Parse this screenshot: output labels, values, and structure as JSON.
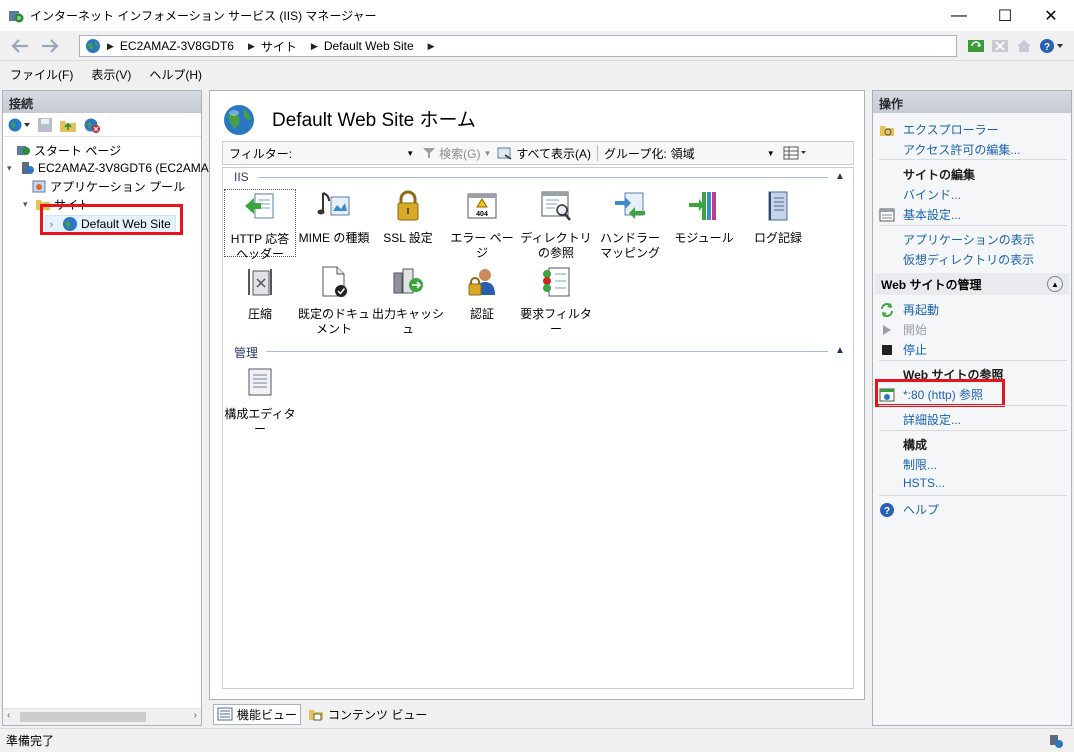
{
  "window": {
    "title": "インターネット インフォメーション サービス (IIS) マネージャー",
    "minimize": "—",
    "maximize": "☐",
    "close": "✕"
  },
  "address": {
    "crumbs": [
      "EC2AMAZ-3V8GDT6",
      "サイト",
      "Default Web Site"
    ]
  },
  "menu": [
    "ファイル(F)",
    "表示(V)",
    "ヘルプ(H)"
  ],
  "connections": {
    "header": "接続",
    "tree": [
      {
        "label": "スタート ページ"
      },
      {
        "label": "EC2AMAZ-3V8GDT6 (EC2AMA"
      },
      {
        "label": "アプリケーション プール"
      },
      {
        "label": "サイト"
      },
      {
        "label": "Default Web Site"
      }
    ]
  },
  "center": {
    "title": "Default Web Site ホーム",
    "filter_label": "フィルター:",
    "search_label": "検索(G)",
    "show_all_label": "すべて表示(A)",
    "group_label": "グループ化:",
    "group_value": "領域",
    "groups": [
      {
        "name": "IIS",
        "features": [
          {
            "label": "HTTP 応答ヘッダー",
            "icon": "http-header-icon"
          },
          {
            "label": "MIME の種類",
            "icon": "mime-icon"
          },
          {
            "label": "SSL 設定",
            "icon": "lock-icon"
          },
          {
            "label": "エラー ページ",
            "icon": "error-page-icon"
          },
          {
            "label": "ディレクトリの参照",
            "icon": "directory-browse-icon"
          },
          {
            "label": "ハンドラー マッピング",
            "icon": "handler-icon"
          },
          {
            "label": "モジュール",
            "icon": "module-icon"
          },
          {
            "label": "ログ記録",
            "icon": "log-icon"
          },
          {
            "label": "圧縮",
            "icon": "compression-icon"
          },
          {
            "label": "既定のドキュメント",
            "icon": "default-doc-icon"
          },
          {
            "label": "出力キャッシュ",
            "icon": "output-cache-icon"
          },
          {
            "label": "認証",
            "icon": "auth-icon"
          },
          {
            "label": "要求フィルター",
            "icon": "request-filter-icon"
          }
        ]
      },
      {
        "name": "管理",
        "features": [
          {
            "label": "構成エディター",
            "icon": "config-editor-icon"
          }
        ]
      }
    ],
    "tabs": [
      {
        "label": "機能ビュー"
      },
      {
        "label": "コンテンツ ビュー"
      }
    ]
  },
  "actions": {
    "header": "操作",
    "explorer": "エクスプローラー",
    "edit_perms": "アクセス許可の編集...",
    "edit_site_head": "サイトの編集",
    "bindings": "バインド...",
    "basic_settings": "基本設定...",
    "view_apps": "アプリケーションの表示",
    "view_vdirs": "仮想ディレクトリの表示",
    "manage_head": "Web サイトの管理",
    "restart": "再起動",
    "start": "開始",
    "stop": "停止",
    "browse_head": "Web サイトの参照",
    "browse_http": "*:80 (http) 参照",
    "advanced": "詳細設定...",
    "config_head": "構成",
    "limits": "制限...",
    "hsts": "HSTS...",
    "help": "ヘルプ"
  },
  "status": {
    "text": "準備完了"
  },
  "colors": {
    "highlight": "#e8141d",
    "link": "#1a62b0"
  }
}
